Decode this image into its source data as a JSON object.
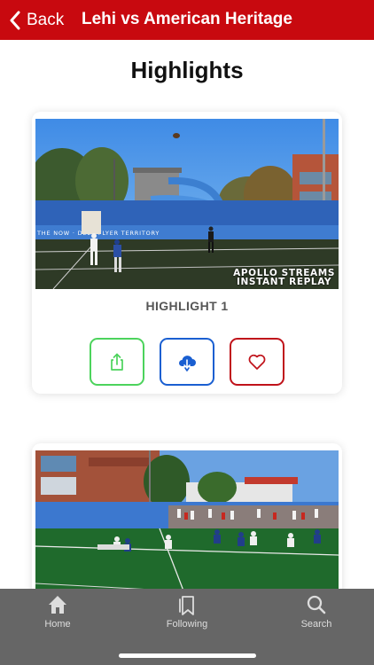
{
  "nav": {
    "back_label": "Back",
    "title": "Lehi vs American Heritage",
    "bar_color": "#c8090f"
  },
  "page": {
    "title": "Highlights"
  },
  "highlights": [
    {
      "label": "HIGHLIGHT 1",
      "watermark_line1": "APOLLO STREAMS",
      "watermark_line2": "INSTANT REPLAY",
      "actions": {
        "share_icon": "share-icon",
        "share_color": "#4cd35c",
        "download_icon": "cloud-download-icon",
        "download_color": "#1a5fd1",
        "favorite_icon": "heart-icon",
        "favorite_color": "#c0121a"
      }
    },
    {}
  ],
  "tab_bar": {
    "tabs": [
      {
        "label": "Home",
        "icon": "home-icon"
      },
      {
        "label": "Following",
        "icon": "bookmarks-icon"
      },
      {
        "label": "Search",
        "icon": "search-icon"
      }
    ]
  }
}
